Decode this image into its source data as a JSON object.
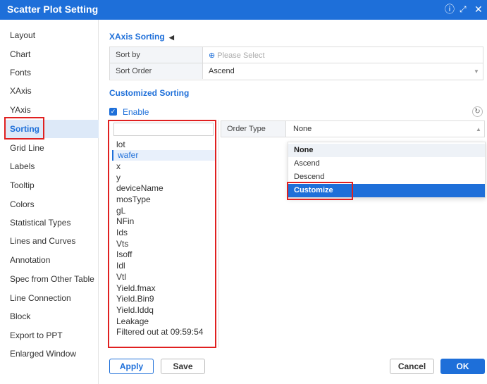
{
  "window": {
    "title": "Scatter Plot Setting"
  },
  "sidebar": {
    "items": [
      {
        "label": "Layout"
      },
      {
        "label": "Chart"
      },
      {
        "label": "Fonts"
      },
      {
        "label": "XAxis"
      },
      {
        "label": "YAxis"
      },
      {
        "label": "Sorting",
        "active": true
      },
      {
        "label": "Grid Line"
      },
      {
        "label": "Labels"
      },
      {
        "label": "Tooltip"
      },
      {
        "label": "Colors"
      },
      {
        "label": "Statistical Types"
      },
      {
        "label": "Lines and Curves"
      },
      {
        "label": "Annotation"
      },
      {
        "label": "Spec from Other Table"
      },
      {
        "label": "Line Connection"
      },
      {
        "label": "Block"
      },
      {
        "label": "Export to PPT"
      },
      {
        "label": "Enlarged Window"
      }
    ]
  },
  "xaxis_sorting": {
    "title": "XAxis Sorting",
    "sort_by_label": "Sort by",
    "sort_by_placeholder": "Please Select",
    "sort_order_label": "Sort Order",
    "sort_order_value": "Ascend"
  },
  "customized_sorting": {
    "title": "Customized Sorting",
    "enable_label": "Enable",
    "enabled": true,
    "fields": [
      "lot",
      "wafer",
      "x",
      "y",
      "deviceName",
      "mosType",
      "gL",
      "NFin",
      "Ids",
      "Vts",
      "Isoff",
      "Idl",
      "Vtl",
      "Yield.fmax",
      "Yield.Bin9",
      "Yield.Iddq",
      "Leakage",
      "Filtered out at 09:59:54"
    ],
    "selected_field": "wafer",
    "order_type_label": "Order Type",
    "order_type_value": "None",
    "order_type_options": [
      "None",
      "Ascend",
      "Descend",
      "Customize"
    ],
    "highlighted_option": "Customize"
  },
  "buttons": {
    "apply": "Apply",
    "save": "Save",
    "cancel": "Cancel",
    "ok": "OK"
  },
  "colors": {
    "accent": "#1e6fd9",
    "highlight_border": "#e02020"
  }
}
